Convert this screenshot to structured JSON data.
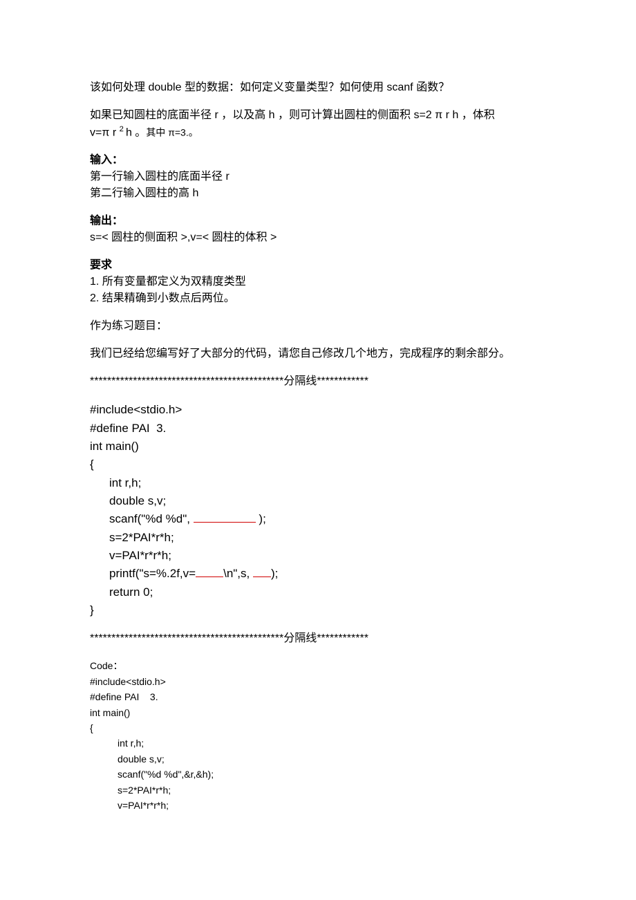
{
  "p1": "该如何处理 double 型的数据：如何定义变量类型？如何使用 scanf 函数？",
  "p2_a": "如果已知圆柱的底面半径 r ，以及高 h ，则可计算出圆柱的侧面积 s=2 π r h ，体积",
  "p2_b_pre": "v=π r ",
  "p2_b_sup": "2 ",
  "p2_b_mid": "h 。",
  "p2_b_post": "其中  π=3.。",
  "input": {
    "label": "输入：",
    "line1": "第一行输入圆柱的底面半径 r",
    "line2": "第二行输入圆柱的高 h"
  },
  "output": {
    "label": "输出：",
    "line1": "s=< 圆柱的侧面积 >,v=< 圆柱的体积 >"
  },
  "req": {
    "label": "要求",
    "line1": "1. 所有变量都定义为双精度类型",
    "line2": "2. 结果精确到小数点后两位。"
  },
  "practice": "作为练习题目：",
  "hint": "我们已经给您编写好了大部分的代码，请您自己修改几个地方，完成程序的剩余部分。",
  "divider": "*********************************************分隔线************",
  "code1": {
    "l1": "#include<stdio.h>",
    "l2": "#define PAI  3.",
    "l3": "int main()",
    "l4": "{",
    "l5": "int r,h;",
    "l6": "double s,v;",
    "l7a": "scanf(\"%d %d\", ",
    "l7b": " );",
    "l8": "s=2*PAI*r*h;",
    "l9": "v=PAI*r*r*h;",
    "l10a": "printf(\"s=%.2f,v=",
    "l10b": "\\n\",s, ",
    "l10c": ");",
    "l11": "return 0;",
    "l12": "}"
  },
  "code2": {
    "label": "Code：",
    "l1": "#include<stdio.h>",
    "l2": "#define PAI    3.",
    "l3": "int main()",
    "l4": "{",
    "l5": "int r,h;",
    "l6": "double s,v;",
    "l7": "scanf(\"%d %d\",&r,&h);",
    "l8": "s=2*PAI*r*h;",
    "l9": "v=PAI*r*r*h;"
  }
}
